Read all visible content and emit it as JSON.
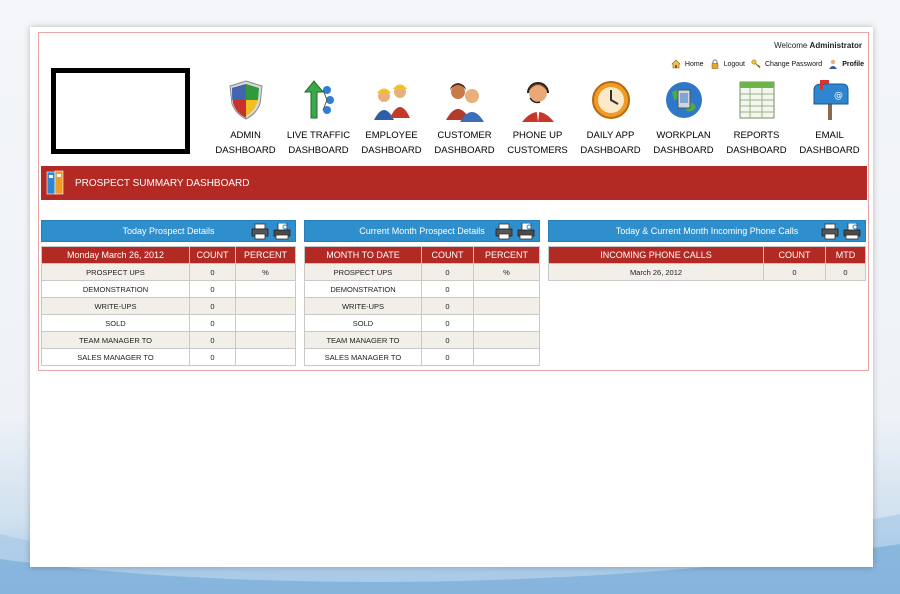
{
  "header": {
    "welcome_prefix": "Welcome",
    "user": "Administrator",
    "links": [
      {
        "label": "Home",
        "icon": "home-icon"
      },
      {
        "label": "Logout",
        "icon": "lock-icon"
      },
      {
        "label": "Change Password",
        "icon": "key-icon"
      },
      {
        "label": "Profile",
        "icon": "user-icon"
      }
    ]
  },
  "nav": [
    {
      "label": "ADMIN\nDASHBOARD",
      "icon": "shield-icon"
    },
    {
      "label": "LIVE TRAFFIC\nDASHBOARD",
      "icon": "network-arrow-icon"
    },
    {
      "label": "EMPLOYEE\nDASHBOARD",
      "icon": "workers-icon"
    },
    {
      "label": "CUSTOMER\nDASHBOARD",
      "icon": "customers-icon"
    },
    {
      "label": "PHONE UP\nCUSTOMERS",
      "icon": "headset-agent-icon"
    },
    {
      "label": "DAILY APP\nDASHBOARD",
      "icon": "clock-icon"
    },
    {
      "label": "WORKPLAN\nDASHBOARD",
      "icon": "globe-icon"
    },
    {
      "label": "REPORTS\nDASHBOARD",
      "icon": "spreadsheet-icon"
    },
    {
      "label": "EMAIL\nDASHBOARD",
      "icon": "mailbox-icon"
    }
  ],
  "banner": {
    "title": "PROSPECT SUMMARY DASHBOARD"
  },
  "panels": [
    {
      "title": "Today Prospect Details",
      "columns": [
        "Monday March 26, 2012",
        "COUNT",
        "PERCENT"
      ],
      "rows": [
        [
          "PROSPECT UPS",
          "0",
          "%"
        ],
        [
          "DEMONSTRATION",
          "0",
          ""
        ],
        [
          "WRITE-UPS",
          "0",
          ""
        ],
        [
          "SOLD",
          "0",
          ""
        ],
        [
          "TEAM MANAGER TO",
          "0",
          ""
        ],
        [
          "SALES MANAGER TO",
          "0",
          ""
        ]
      ]
    },
    {
      "title": "Current Month Prospect Details",
      "columns": [
        "MONTH TO DATE",
        "COUNT",
        "PERCENT"
      ],
      "rows": [
        [
          "PROSPECT UPS",
          "0",
          "%"
        ],
        [
          "DEMONSTRATION",
          "0",
          ""
        ],
        [
          "WRITE-UPS",
          "0",
          ""
        ],
        [
          "SOLD",
          "0",
          ""
        ],
        [
          "TEAM MANAGER TO",
          "0",
          ""
        ],
        [
          "SALES MANAGER TO",
          "0",
          ""
        ]
      ]
    },
    {
      "title": "Today & Current Month Incoming Phone Calls",
      "columns": [
        "INCOMING PHONE CALLS",
        "COUNT",
        "MTD"
      ],
      "rows": [
        [
          "March 26, 2012",
          "0",
          "0"
        ]
      ]
    }
  ],
  "colors": {
    "banner": "#b32a24",
    "panel_head": "#2f8fcd",
    "frame_border": "#e8a6a6"
  }
}
